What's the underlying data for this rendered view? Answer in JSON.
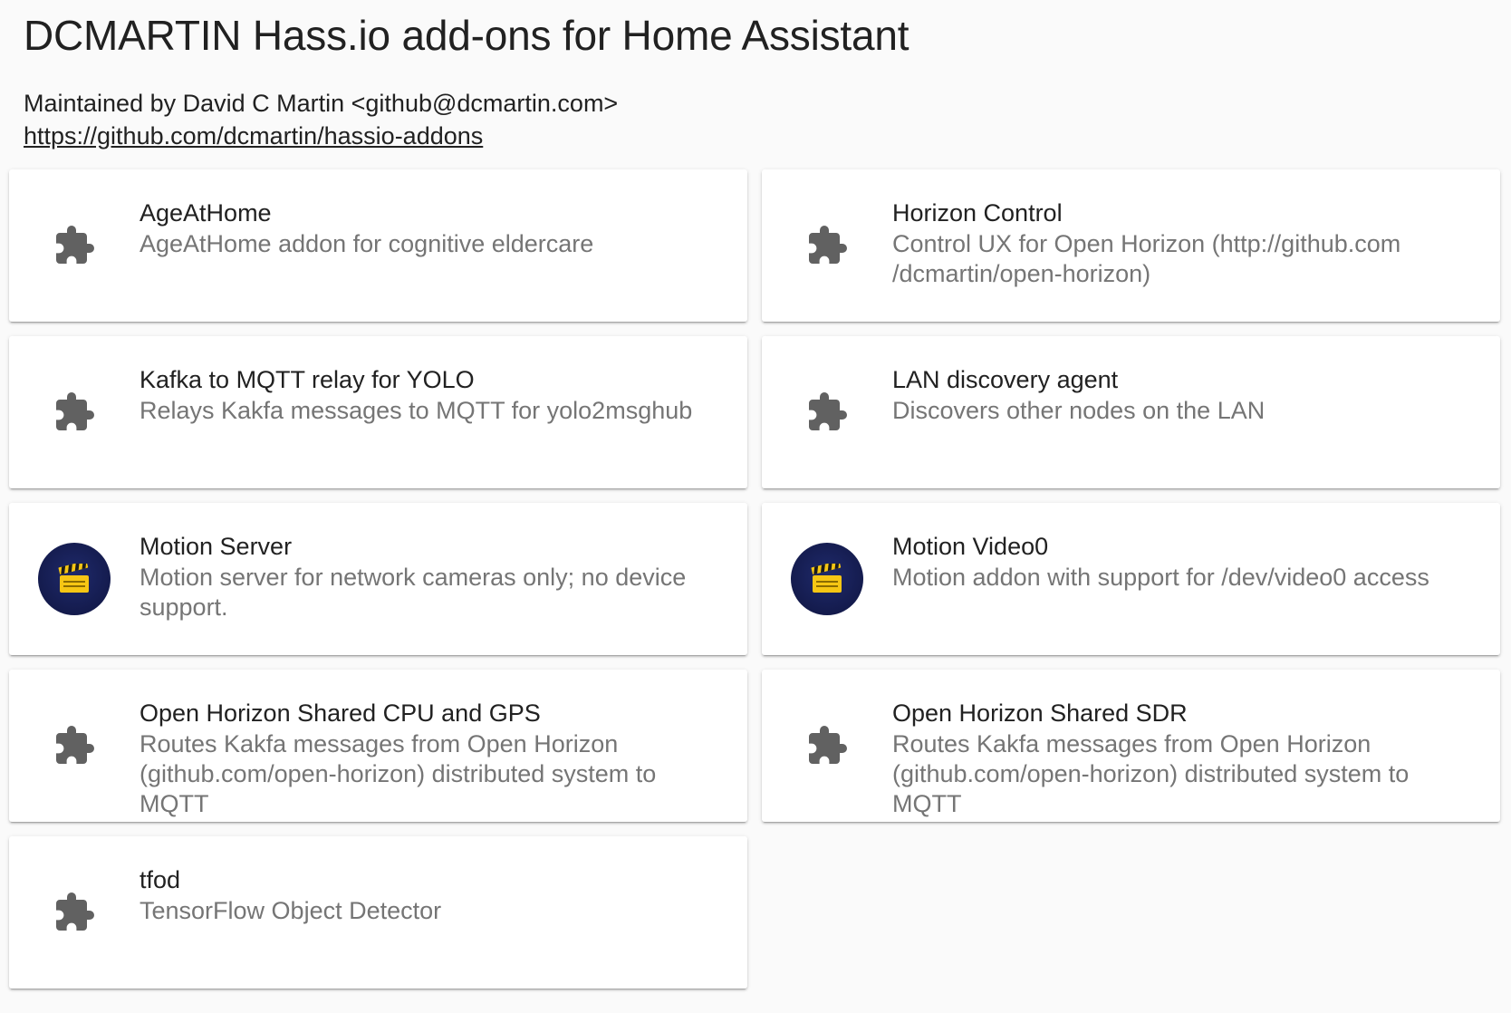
{
  "repository": {
    "title": "DCMARTIN Hass.io add-ons for Home Assistant",
    "maintainer": "Maintained by David C Martin <github@dcmartin.com>",
    "url": "https://github.com/dcmartin/hassio-addons"
  },
  "addons": [
    {
      "name": "AgeAtHome",
      "description": "AgeAtHome addon for cognitive eldercare",
      "icon": "puzzle-piece-icon"
    },
    {
      "name": "Horizon Control",
      "description": "Control UX for Open Horizon (http://github.com /dcmartin/open-horizon)",
      "icon": "puzzle-piece-icon"
    },
    {
      "name": "Kafka to MQTT relay for YOLO",
      "description": "Relays Kakfa messages to MQTT for yolo2msghub",
      "icon": "puzzle-piece-icon"
    },
    {
      "name": "LAN discovery agent",
      "description": "Discovers other nodes on the LAN",
      "icon": "puzzle-piece-icon"
    },
    {
      "name": "Motion Server",
      "description": "Motion server for network cameras only; no device support.",
      "icon": "clapperboard-logo"
    },
    {
      "name": "Motion Video0",
      "description": "Motion addon with support for /dev/video0 access",
      "icon": "clapperboard-logo"
    },
    {
      "name": "Open Horizon Shared CPU and GPS",
      "description": "Routes Kakfa messages from Open Horizon (github.com/open-horizon) distributed system to MQTT",
      "icon": "puzzle-piece-icon"
    },
    {
      "name": "Open Horizon Shared SDR",
      "description": "Routes Kakfa messages from Open Horizon (github.com/open-horizon) distributed system to MQTT",
      "icon": "puzzle-piece-icon"
    },
    {
      "name": "tfod",
      "description": "TensorFlow Object Detector",
      "icon": "puzzle-piece-icon"
    }
  ],
  "colors": {
    "background": "#fafafa",
    "card": "#ffffff",
    "title_text": "#212121",
    "secondary_text": "#757575",
    "icon": "#616161",
    "avatar_bg": "#141b4d",
    "clapper_yellow": "#f6c614"
  }
}
